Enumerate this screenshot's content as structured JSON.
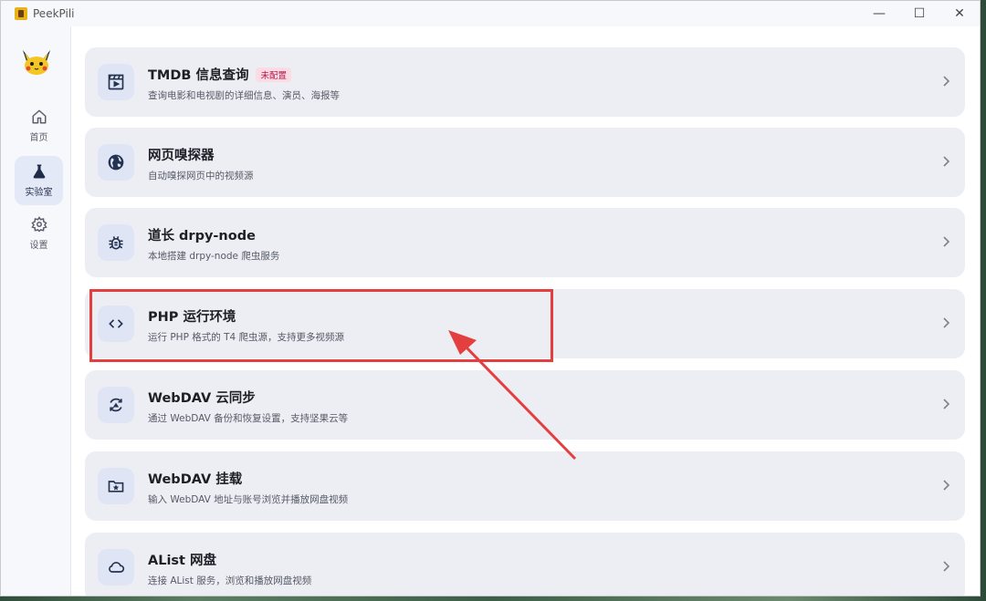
{
  "app": {
    "title": "PeekPili"
  },
  "window_controls": {
    "minimize": "—",
    "maximize": "☐",
    "close": "✕"
  },
  "sidebar": {
    "items": [
      {
        "label": "首页",
        "icon": "home-icon"
      },
      {
        "label": "实验室",
        "icon": "flask-icon",
        "active": true
      },
      {
        "label": "设置",
        "icon": "gear-icon"
      }
    ]
  },
  "cards": [
    {
      "title": "TMDB 信息查询",
      "badge": "未配置",
      "desc": "查询电影和电视剧的详细信息、演员、海报等",
      "icon": "movie-clapper-icon"
    },
    {
      "title": "网页嗅探器",
      "desc": "自动嗅探网页中的视频源",
      "icon": "globe-icon"
    },
    {
      "title": "道长 drpy-node",
      "desc": "本地搭建 drpy-node 爬虫服务",
      "icon": "bug-icon"
    },
    {
      "title": "PHP 运行环境",
      "desc": "运行 PHP 格式的 T4 爬虫源，支持更多视频源",
      "icon": "code-icon"
    },
    {
      "title": "WebDAV 云同步",
      "desc": "通过 WebDAV 备份和恢复设置，支持坚果云等",
      "icon": "sync-icon"
    },
    {
      "title": "WebDAV 挂载",
      "desc": "输入 WebDAV 地址与账号浏览并播放网盘视频",
      "icon": "folder-star-icon"
    },
    {
      "title": "AList 网盘",
      "desc": "连接 AList 服务，浏览和播放网盘视频",
      "icon": "cloud-icon"
    }
  ],
  "colors": {
    "annotation": "#e43f3f",
    "badge_text": "#b5174f",
    "active_nav_bg": "#e3e9f7"
  }
}
